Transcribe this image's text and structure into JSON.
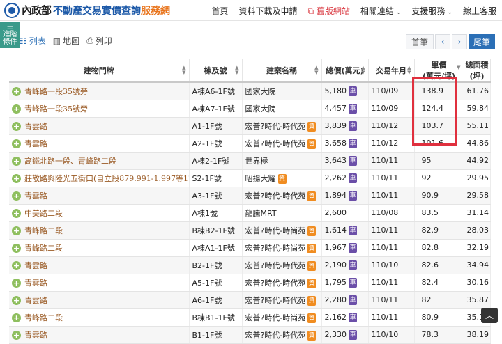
{
  "header": {
    "ministry": "內政部",
    "title_main": "不動產交易實價查詢",
    "title_accent": "服務網",
    "nav": [
      {
        "label": "首頁",
        "caret": false,
        "red": false
      },
      {
        "label": "資料下載及申請",
        "caret": false,
        "red": false
      },
      {
        "label": "舊版網站",
        "caret": false,
        "red": true,
        "icon": "external-link-icon"
      },
      {
        "label": "相關連結",
        "caret": true,
        "red": false
      },
      {
        "label": "支援服務",
        "caret": true,
        "red": false
      },
      {
        "label": "線上客服",
        "caret": false,
        "red": false
      }
    ]
  },
  "toolbar": {
    "advanced_filter": [
      "進階",
      "條件"
    ],
    "views": [
      {
        "label": "列表",
        "icon": "list-icon",
        "active": true
      },
      {
        "label": "地圖",
        "icon": "map-icon",
        "active": false
      },
      {
        "label": "列印",
        "icon": "print-icon",
        "active": false
      }
    ],
    "pager": {
      "first": "首筆",
      "prev": "‹",
      "next": "›",
      "last": "尾筆"
    }
  },
  "table": {
    "columns": [
      {
        "label": "建物門牌",
        "sortable": true
      },
      {
        "label": "棟及號",
        "sortable": true
      },
      {
        "label": "建案名稱",
        "sortable": true
      },
      {
        "label": "總價(萬元)",
        "sortable": true
      },
      {
        "label": "交易年月",
        "sortable": true
      },
      {
        "label": "單價\n(萬元/坪)",
        "sortable": true
      },
      {
        "label": "總面積\n(坪)",
        "sortable": false
      }
    ],
    "rows": [
      {
        "address": "青峰路一段35號旁",
        "unit": "A棟A6-1F號",
        "project": "國家大院",
        "project_badge": "",
        "price": "5,180",
        "price_badge": "車",
        "date": "110/09",
        "unit_price": "138.9",
        "area": "61.76"
      },
      {
        "address": "青峰路一段35號旁",
        "unit": "A棟A7-1F號",
        "project": "國家大院",
        "project_badge": "",
        "price": "4,457",
        "price_badge": "車",
        "date": "110/09",
        "unit_price": "124.4",
        "area": "59.84"
      },
      {
        "address": "青雲路",
        "unit": "A1-1F號",
        "project": "宏普?時代-時代苑",
        "project_badge": "資",
        "price": "3,839",
        "price_badge": "車",
        "date": "110/12",
        "unit_price": "103.7",
        "area": "55.11"
      },
      {
        "address": "青雲路",
        "unit": "A2-1F號",
        "project": "宏普?時代-時代苑",
        "project_badge": "資",
        "price": "3,658",
        "price_badge": "車",
        "date": "110/12",
        "unit_price": "101.6",
        "area": "44.86"
      },
      {
        "address": "高鐵北路一段、青峰路二段",
        "unit": "A棟2-1F號",
        "project": "世界極",
        "project_badge": "",
        "price": "3,643",
        "price_badge": "車",
        "date": "110/11",
        "unit_price": "95",
        "area": "44.92"
      },
      {
        "address": "莊敬路與陸光五街口(自立段879.991-1.997等17筆)",
        "unit": "S2-1F號",
        "project": "昭揚大耀",
        "project_badge": "資",
        "price": "2,262",
        "price_badge": "車",
        "date": "110/11",
        "unit_price": "92",
        "area": "29.95"
      },
      {
        "address": "青雲路",
        "unit": "A3-1F號",
        "project": "宏普?時代-時代苑",
        "project_badge": "資",
        "price": "1,894",
        "price_badge": "車",
        "date": "110/11",
        "unit_price": "90.9",
        "area": "29.58"
      },
      {
        "address": "中美路二段",
        "unit": "A棟1號",
        "project": "龍騰MRT",
        "project_badge": "",
        "price": "2,600",
        "price_badge": "",
        "date": "110/08",
        "unit_price": "83.5",
        "area": "31.14"
      },
      {
        "address": "青峰路二段",
        "unit": "B棟B2-1F號",
        "project": "宏普?時代-時尚苑",
        "project_badge": "資",
        "price": "1,614",
        "price_badge": "車",
        "date": "110/11",
        "unit_price": "82.9",
        "area": "28.03"
      },
      {
        "address": "青峰路二段",
        "unit": "A棟A1-1F號",
        "project": "宏普?時代-時尚苑",
        "project_badge": "資",
        "price": "1,967",
        "price_badge": "車",
        "date": "110/11",
        "unit_price": "82.8",
        "area": "32.19"
      },
      {
        "address": "青雲路",
        "unit": "B2-1F號",
        "project": "宏普?時代-時代苑",
        "project_badge": "資",
        "price": "2,190",
        "price_badge": "車",
        "date": "110/10",
        "unit_price": "82.6",
        "area": "34.94"
      },
      {
        "address": "青雲路",
        "unit": "A5-1F號",
        "project": "宏普?時代-時代苑",
        "project_badge": "資",
        "price": "1,795",
        "price_badge": "車",
        "date": "110/11",
        "unit_price": "82.4",
        "area": "30.16"
      },
      {
        "address": "青雲路",
        "unit": "A6-1F號",
        "project": "宏普?時代-時代苑",
        "project_badge": "資",
        "price": "2,280",
        "price_badge": "車",
        "date": "110/11",
        "unit_price": "82",
        "area": "35.87"
      },
      {
        "address": "青峰路二段",
        "unit": "B棟B1-1F號",
        "project": "宏普?時代-時尚苑",
        "project_badge": "資",
        "price": "2,162",
        "price_badge": "車",
        "date": "110/11",
        "unit_price": "80.9",
        "area": "35.1"
      },
      {
        "address": "青雲路",
        "unit": "B1-1F號",
        "project": "宏普?時代-時代苑",
        "project_badge": "資",
        "price": "2,330",
        "price_badge": "車",
        "date": "110/10",
        "unit_price": "78.3",
        "area": "38.19"
      }
    ]
  },
  "colors": {
    "brand": "#1e5aa8",
    "accent": "#e8731a",
    "highlight": "#e0303e",
    "address_text": "#9a5a24"
  }
}
